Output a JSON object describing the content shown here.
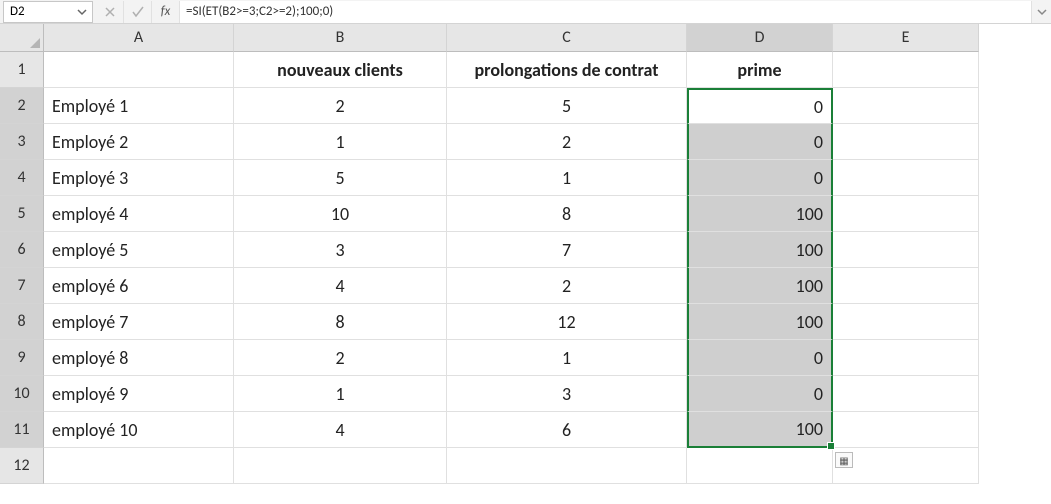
{
  "nameBox": "D2",
  "formula": "=SI(ET(B2>=3;C2>=2);100;0)",
  "columns": [
    "A",
    "B",
    "C",
    "D",
    "E"
  ],
  "rowNumbers": [
    "1",
    "2",
    "3",
    "4",
    "5",
    "6",
    "7",
    "8",
    "9",
    "10",
    "11",
    "12"
  ],
  "header": {
    "A": "",
    "B": "nouveaux clients",
    "C": "prolongations de contrat",
    "D": "prime",
    "E": ""
  },
  "rows": [
    {
      "A": "Employé 1",
      "B": "2",
      "C": "5",
      "D": "0",
      "E": ""
    },
    {
      "A": "Employé 2",
      "B": "1",
      "C": "2",
      "D": "0",
      "E": ""
    },
    {
      "A": "Employé 3",
      "B": "5",
      "C": "1",
      "D": "0",
      "E": ""
    },
    {
      "A": "employé 4",
      "B": "10",
      "C": "8",
      "D": "100",
      "E": ""
    },
    {
      "A": "employé 5",
      "B": "3",
      "C": "7",
      "D": "100",
      "E": ""
    },
    {
      "A": "employé 6",
      "B": "4",
      "C": "2",
      "D": "100",
      "E": ""
    },
    {
      "A": "employé 7",
      "B": "8",
      "C": "12",
      "D": "100",
      "E": ""
    },
    {
      "A": "employé 8",
      "B": "2",
      "C": "1",
      "D": "0",
      "E": ""
    },
    {
      "A": "employé 9",
      "B": "1",
      "C": "3",
      "D": "0",
      "E": ""
    },
    {
      "A": "employé 10",
      "B": "4",
      "C": "6",
      "D": "100",
      "E": ""
    }
  ],
  "chart_data": {
    "type": "table",
    "title": "",
    "columns": [
      "nouveaux clients",
      "prolongations de contrat",
      "prime"
    ],
    "categories": [
      "Employé 1",
      "Employé 2",
      "Employé 3",
      "employé 4",
      "employé 5",
      "employé 6",
      "employé 7",
      "employé 8",
      "employé 9",
      "employé 10"
    ],
    "series": [
      {
        "name": "nouveaux clients",
        "values": [
          2,
          1,
          5,
          10,
          3,
          4,
          8,
          2,
          1,
          4
        ]
      },
      {
        "name": "prolongations de contrat",
        "values": [
          5,
          2,
          1,
          8,
          7,
          2,
          12,
          1,
          3,
          6
        ]
      },
      {
        "name": "prime",
        "values": [
          0,
          0,
          0,
          100,
          100,
          100,
          100,
          0,
          0,
          100
        ]
      }
    ]
  }
}
